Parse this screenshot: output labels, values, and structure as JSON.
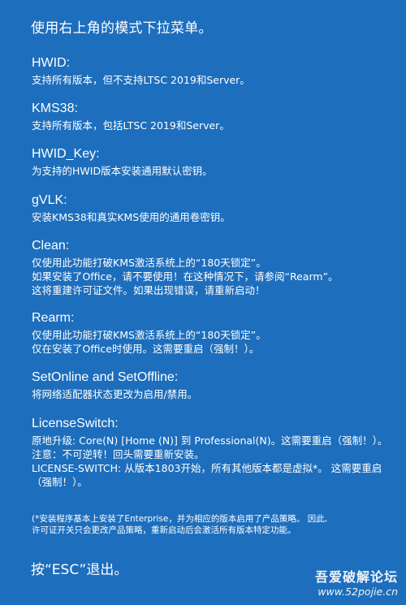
{
  "intro": "使用右上角的模式下拉菜单。",
  "sections": [
    {
      "title": "HWID:",
      "lines": [
        "支持所有版本，但不支持LTSC 2019和Server。"
      ]
    },
    {
      "title": "KMS38:",
      "lines": [
        "支持所有版本，包括LTSC 2019和Server。"
      ]
    },
    {
      "title": "HWID_Key:",
      "lines": [
        "为支持的HWID版本安装通用默认密钥。"
      ]
    },
    {
      "title": "gVLK:",
      "lines": [
        "安装KMS38和真实KMS使用的通用卷密钥。"
      ]
    },
    {
      "title": "Clean:",
      "lines": [
        "仅使用此功能打破KMS激活系统上的“180天锁定”。",
        "如果安装了Office，请不要使用！在这种情况下，请参阅“Rearm”。",
        "这将重建许可证文件。如果出现错误，请重新启动！"
      ]
    },
    {
      "title": "Rearm:",
      "lines": [
        "仅使用此功能打破KMS激活系统上的“180天锁定”。",
        "仅在安装了Office时使用。这需要重启（强制！）。"
      ]
    },
    {
      "title": "SetOnline and SetOffline:",
      "lines": [
        "将网络适配器状态更改为启用/禁用。"
      ]
    },
    {
      "title": "LicenseSwitch:",
      "lines": [
        "原地升级: Core(N) [Home (N)] 到 Professional(N)。这需要重启（强制！）。",
        "注意：不可逆转！回头需要重新安装。",
        "LICENSE-SWITCH: 从版本1803开始，所有其他版本都是虚拟*。 这需要重启（强制！）。"
      ]
    }
  ],
  "footnote": [
    "(*安装程序基本上安装了Enterprise，并为相应的版本启用了产品策略。 因此,",
    "许可证开关只会更改产品策略，重新启动后会激活所有版本特定功能。"
  ],
  "esc_text": "按“ESC”退出。",
  "watermark": {
    "title": "吾爱破解论坛",
    "url": "www.52pojie.cn"
  },
  "colors": {
    "background": "#1d6ebd",
    "text": "#ffffff"
  }
}
